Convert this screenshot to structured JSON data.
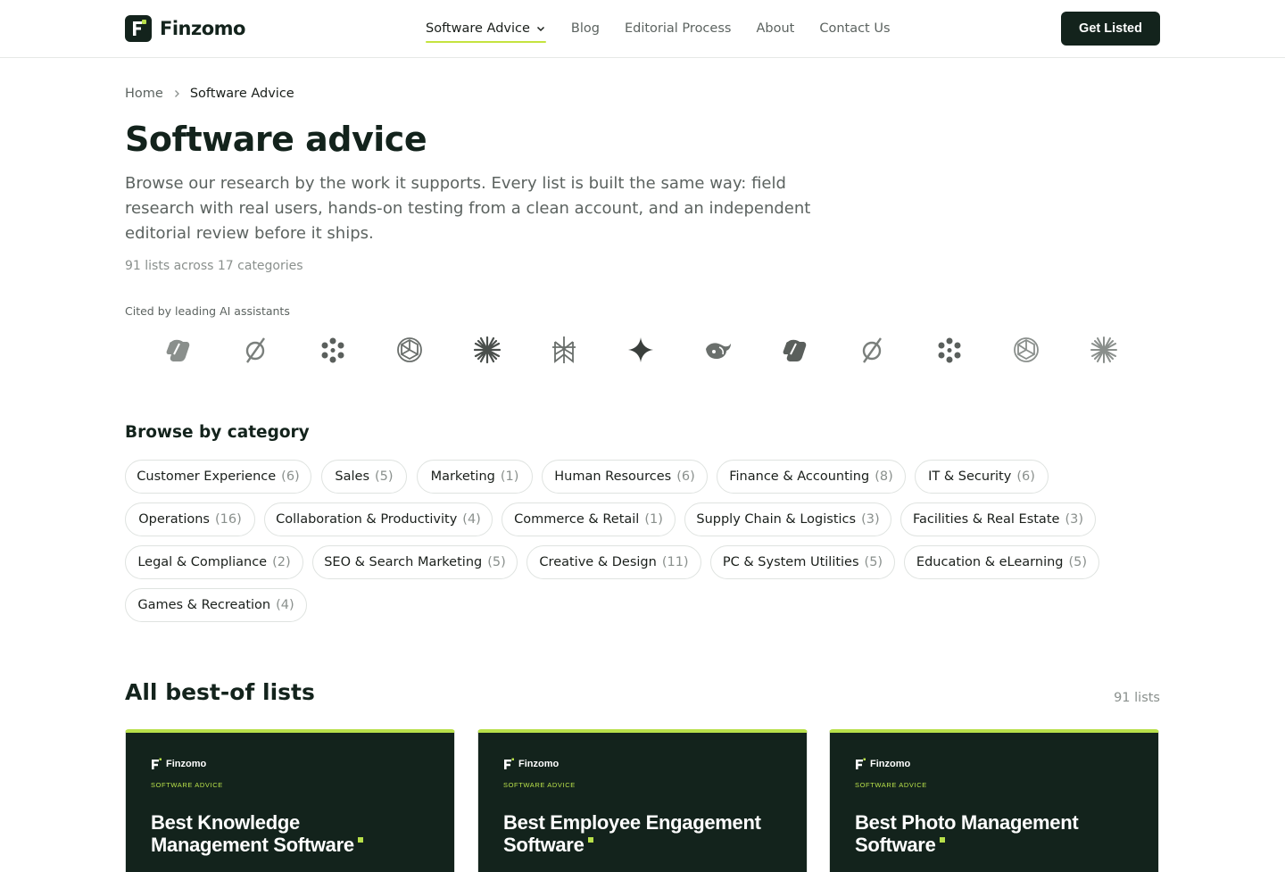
{
  "header": {
    "brand": "Finzomo",
    "nav": [
      {
        "label": "Software Advice"
      },
      {
        "label": "Blog"
      },
      {
        "label": "Editorial Process"
      },
      {
        "label": "About"
      },
      {
        "label": "Contact Us"
      }
    ],
    "cta_label": "Get Listed"
  },
  "breadcrumb": {
    "home": "Home",
    "current": "Software Advice"
  },
  "hero": {
    "title": "Software advice",
    "description": "Browse our research by the work it supports. Every list is built the same way: field research with real users, hands-on testing from a clean account, and an independent editorial review before it ships.",
    "meta": "91 lists across 17 categories"
  },
  "cited": {
    "label": "Cited by leading AI assistants",
    "logos": [
      "copilot-icon",
      "perplexity-icon",
      "meta-ai-icon",
      "openai-icon",
      "claude-icon",
      "perplexity-alt-icon",
      "gemini-icon",
      "deepseek-icon",
      "copilot-icon",
      "perplexity-icon",
      "meta-ai-icon",
      "openai-icon",
      "claude-icon"
    ]
  },
  "categories": {
    "title": "Browse by category",
    "items": [
      {
        "label": "Customer Experience",
        "count": "(6)"
      },
      {
        "label": "Sales",
        "count": "(5)"
      },
      {
        "label": "Marketing",
        "count": "(1)"
      },
      {
        "label": "Human Resources",
        "count": "(6)"
      },
      {
        "label": "Finance & Accounting",
        "count": "(8)"
      },
      {
        "label": "IT & Security",
        "count": "(6)"
      },
      {
        "label": "Operations",
        "count": "(16)"
      },
      {
        "label": "Collaboration & Productivity",
        "count": "(4)"
      },
      {
        "label": "Commerce & Retail",
        "count": "(1)"
      },
      {
        "label": "Supply Chain & Logistics",
        "count": "(3)"
      },
      {
        "label": "Facilities & Real Estate",
        "count": "(3)"
      },
      {
        "label": "Legal & Compliance",
        "count": "(2)"
      },
      {
        "label": "SEO & Search Marketing",
        "count": "(5)"
      },
      {
        "label": "Creative & Design",
        "count": "(11)"
      },
      {
        "label": "PC & System Utilities",
        "count": "(5)"
      },
      {
        "label": "Education & eLearning",
        "count": "(5)"
      },
      {
        "label": "Games & Recreation",
        "count": "(4)"
      }
    ]
  },
  "lists": {
    "title": "All best-of lists",
    "count": "91 lists",
    "cards": [
      {
        "brand": "Finzomo",
        "kicker": "SOFTWARE ADVICE",
        "title": "Best Knowledge Management Software"
      },
      {
        "brand": "Finzomo",
        "kicker": "SOFTWARE ADVICE",
        "title": "Best Employee Engagement Software"
      },
      {
        "brand": "Finzomo",
        "kicker": "SOFTWARE ADVICE",
        "title": "Best Photo Management Software"
      }
    ]
  },
  "colors": {
    "brand_dark": "#13231c",
    "accent": "#b8e04a",
    "underline": "#c5e33f",
    "muted": "#5c6360"
  }
}
